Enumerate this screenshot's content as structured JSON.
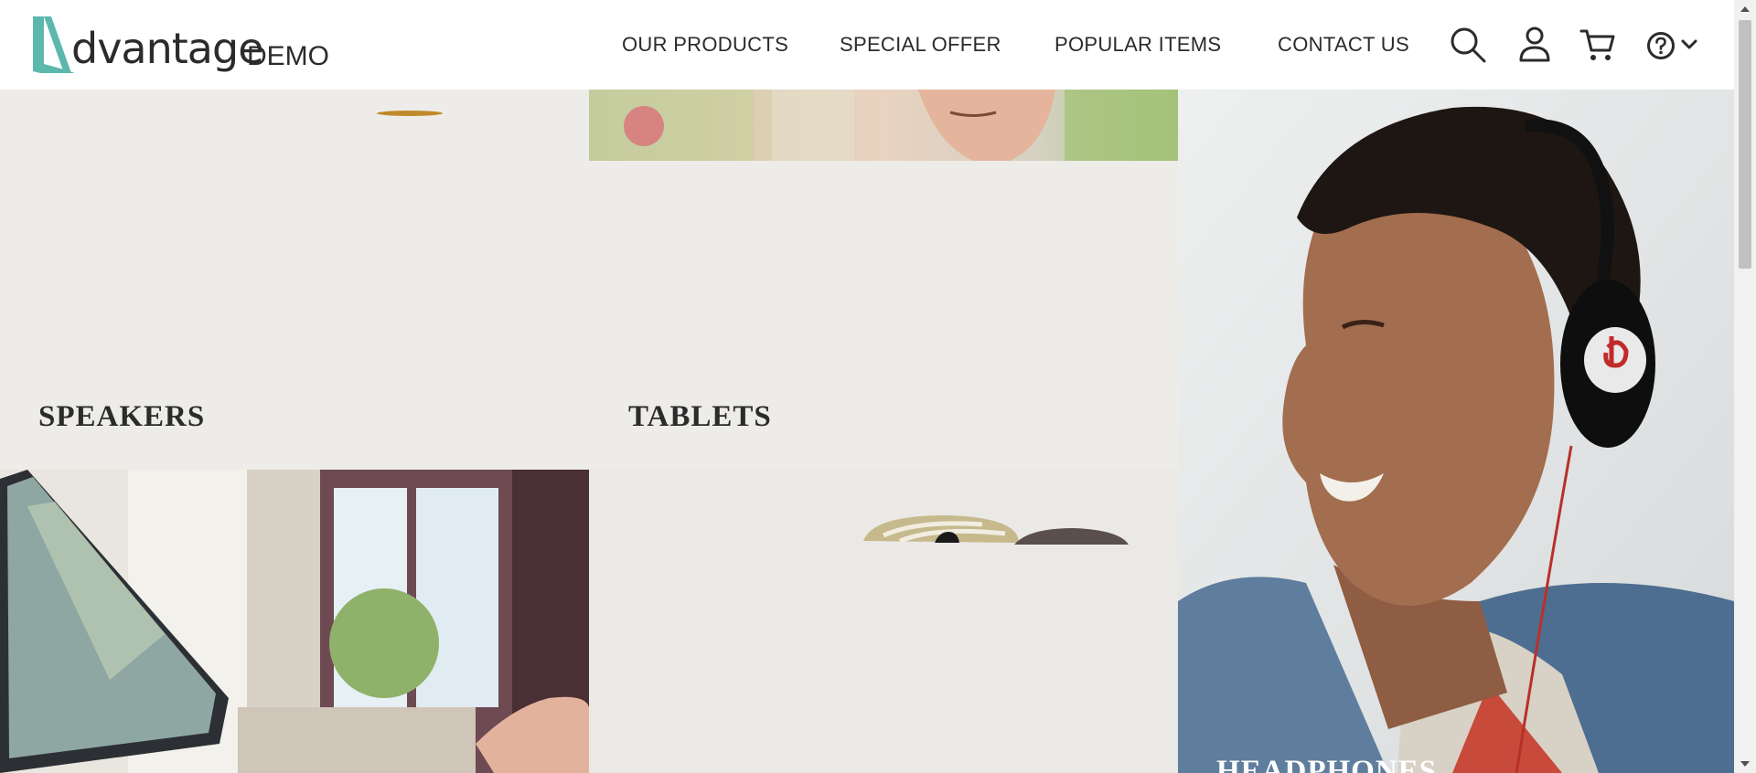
{
  "brand": {
    "logo_word": "dvantage",
    "logo_suffix": "DEMO",
    "accent_color": "#5cb8ad"
  },
  "nav": {
    "items": [
      {
        "label": "OUR PRODUCTS"
      },
      {
        "label": "SPECIAL OFFER"
      },
      {
        "label": "POPULAR ITEMS"
      },
      {
        "label": "CONTACT US"
      }
    ]
  },
  "header_icons": [
    "search-icon",
    "user-icon",
    "cart-icon",
    "help-icon",
    "chevron-down-icon"
  ],
  "categories": {
    "speakers": {
      "label": "SPEAKERS"
    },
    "tablets": {
      "label": "TABLETS"
    },
    "headphones": {
      "label": "HEADPHONES"
    },
    "laptops": {
      "label": ""
    },
    "mice": {
      "label": ""
    }
  },
  "colors": {
    "tile_background": "#eeece9",
    "text": "#2b2b2b"
  }
}
